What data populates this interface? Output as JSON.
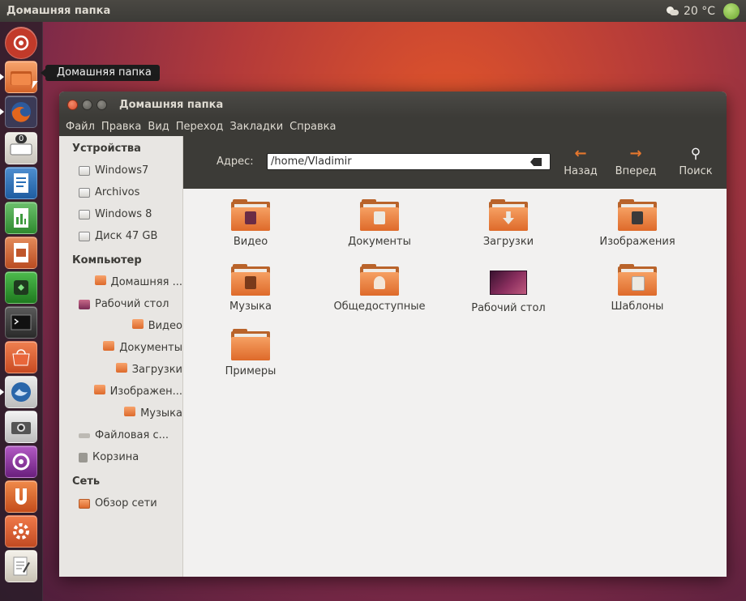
{
  "panel": {
    "title": "Домашняя папка",
    "temperature": "20 °C"
  },
  "tooltip": "Домашняя папка",
  "launcher": {
    "items": [
      {
        "name": "dash",
        "color": "#c0392b"
      },
      {
        "name": "files",
        "color": "#e07b39"
      },
      {
        "name": "firefox",
        "color": "#d9632a"
      },
      {
        "name": "monitor",
        "color": "#d4d0c8"
      },
      {
        "name": "writer",
        "color": "#2a6fb7"
      },
      {
        "name": "calc",
        "color": "#3d9a3d"
      },
      {
        "name": "impress",
        "color": "#c0562b"
      },
      {
        "name": "vpn",
        "color": "#2f8f2f"
      },
      {
        "name": "terminal",
        "color": "#3a3a3a"
      },
      {
        "name": "software",
        "color": "#e0603a"
      },
      {
        "name": "thunderbird",
        "color": "#2a66aa"
      },
      {
        "name": "camera",
        "color": "#c9c9c9"
      },
      {
        "name": "mediaplayer",
        "color": "#8e2c9b"
      },
      {
        "name": "ubuntuone",
        "color": "#d85a27"
      },
      {
        "name": "settings",
        "color": "#e06a3a"
      },
      {
        "name": "notes",
        "color": "#d8d3c8"
      }
    ],
    "monitor_badge": "0"
  },
  "window": {
    "title": "Домашняя папка",
    "menu": [
      "Файл",
      "Правка",
      "Вид",
      "Переход",
      "Закладки",
      "Справка"
    ]
  },
  "toolbar": {
    "address_label": "Адрес:",
    "path": "/home/Vladimir",
    "back": "Назад",
    "forward": "Вперед",
    "search": "Поиск"
  },
  "sidebar": {
    "devices_title": "Устройства",
    "devices": [
      "Windows7",
      "Archivos",
      "Windows 8",
      "Диск 47 GB"
    ],
    "computer_title": "Компьютер",
    "computer": [
      "Домашняя ...",
      "Рабочий стол",
      "Видео",
      "Документы",
      "Загрузки",
      "Изображен...",
      "Музыка",
      "Файловая с...",
      "Корзина"
    ],
    "network_title": "Сеть",
    "network": [
      "Обзор сети"
    ]
  },
  "files": [
    "Видео",
    "Документы",
    "Загрузки",
    "Изображения",
    "Музыка",
    "Общедоступные",
    "Рабочий стол",
    "Шаблоны",
    "Примеры"
  ],
  "colors": {
    "accent": "#dd6a2c",
    "panel": "#3c3b37"
  }
}
